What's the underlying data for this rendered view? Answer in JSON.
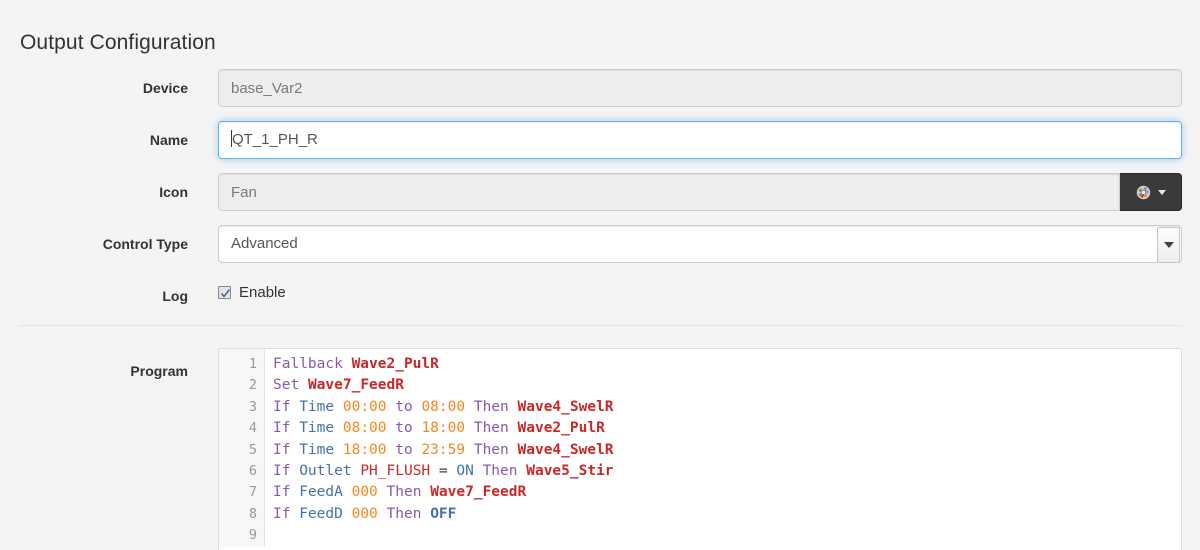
{
  "page": {
    "title": "Output Configuration"
  },
  "form": {
    "device": {
      "label": "Device",
      "value": "base_Var2",
      "readonly": true
    },
    "name": {
      "label": "Name",
      "value": "QT_1_PH_R",
      "focused": true
    },
    "icon": {
      "label": "Icon",
      "value": "Fan",
      "readonly": true,
      "button_icon": "fan-icon",
      "button_caret": "caret-down-icon"
    },
    "control_type": {
      "label": "Control Type",
      "value": "Advanced",
      "options": [
        "Advanced"
      ]
    },
    "log": {
      "label": "Log",
      "checkbox_label": "Enable",
      "checked": true
    },
    "program": {
      "label": "Program"
    }
  },
  "editor": {
    "lines": [
      {
        "number": "1",
        "tokens": [
          {
            "t": "Fallback",
            "c": "kw"
          },
          {
            "t": " ",
            "c": "op"
          },
          {
            "t": "Wave2_PulR",
            "c": "str"
          }
        ]
      },
      {
        "number": "2",
        "tokens": [
          {
            "t": "Set",
            "c": "kw"
          },
          {
            "t": " ",
            "c": "op"
          },
          {
            "t": "Wave7_FeedR",
            "c": "str"
          }
        ]
      },
      {
        "number": "3",
        "tokens": [
          {
            "t": "If",
            "c": "kw"
          },
          {
            "t": " ",
            "c": "op"
          },
          {
            "t": "Time",
            "c": "fn"
          },
          {
            "t": " ",
            "c": "op"
          },
          {
            "t": "00:00",
            "c": "num"
          },
          {
            "t": " ",
            "c": "op"
          },
          {
            "t": "to",
            "c": "kw"
          },
          {
            "t": " ",
            "c": "op"
          },
          {
            "t": "08:00",
            "c": "num"
          },
          {
            "t": " ",
            "c": "op"
          },
          {
            "t": "Then",
            "c": "kw"
          },
          {
            "t": " ",
            "c": "op"
          },
          {
            "t": "Wave4_SwelR",
            "c": "str"
          }
        ]
      },
      {
        "number": "4",
        "tokens": [
          {
            "t": "If",
            "c": "kw"
          },
          {
            "t": " ",
            "c": "op"
          },
          {
            "t": "Time",
            "c": "fn"
          },
          {
            "t": " ",
            "c": "op"
          },
          {
            "t": "08:00",
            "c": "num"
          },
          {
            "t": " ",
            "c": "op"
          },
          {
            "t": "to",
            "c": "kw"
          },
          {
            "t": " ",
            "c": "op"
          },
          {
            "t": "18:00",
            "c": "num"
          },
          {
            "t": " ",
            "c": "op"
          },
          {
            "t": "Then",
            "c": "kw"
          },
          {
            "t": " ",
            "c": "op"
          },
          {
            "t": "Wave2_PulR",
            "c": "str"
          }
        ]
      },
      {
        "number": "5",
        "tokens": [
          {
            "t": "If",
            "c": "kw"
          },
          {
            "t": " ",
            "c": "op"
          },
          {
            "t": "Time",
            "c": "fn"
          },
          {
            "t": " ",
            "c": "op"
          },
          {
            "t": "18:00",
            "c": "num"
          },
          {
            "t": " ",
            "c": "op"
          },
          {
            "t": "to",
            "c": "kw"
          },
          {
            "t": " ",
            "c": "op"
          },
          {
            "t": "23:59",
            "c": "num"
          },
          {
            "t": " ",
            "c": "op"
          },
          {
            "t": "Then",
            "c": "kw"
          },
          {
            "t": " ",
            "c": "op"
          },
          {
            "t": "Wave4_SwelR",
            "c": "str"
          }
        ]
      },
      {
        "number": "6",
        "tokens": [
          {
            "t": "If",
            "c": "kw"
          },
          {
            "t": " ",
            "c": "op"
          },
          {
            "t": "Outlet",
            "c": "fn"
          },
          {
            "t": " ",
            "c": "op"
          },
          {
            "t": "PH_FLUSH",
            "c": "var"
          },
          {
            "t": " ",
            "c": "op"
          },
          {
            "t": "=",
            "c": "op"
          },
          {
            "t": " ",
            "c": "op"
          },
          {
            "t": "ON",
            "c": "fn"
          },
          {
            "t": " ",
            "c": "op"
          },
          {
            "t": "Then",
            "c": "kw"
          },
          {
            "t": " ",
            "c": "op"
          },
          {
            "t": "Wave5_Stir",
            "c": "str"
          }
        ]
      },
      {
        "number": "7",
        "tokens": [
          {
            "t": "If",
            "c": "kw"
          },
          {
            "t": " ",
            "c": "op"
          },
          {
            "t": "FeedA",
            "c": "fn"
          },
          {
            "t": " ",
            "c": "op"
          },
          {
            "t": "000",
            "c": "num"
          },
          {
            "t": " ",
            "c": "op"
          },
          {
            "t": "Then",
            "c": "kw"
          },
          {
            "t": " ",
            "c": "op"
          },
          {
            "t": "Wave7_FeedR",
            "c": "str"
          }
        ]
      },
      {
        "number": "8",
        "tokens": [
          {
            "t": "If",
            "c": "kw"
          },
          {
            "t": " ",
            "c": "op"
          },
          {
            "t": "FeedD",
            "c": "fn"
          },
          {
            "t": " ",
            "c": "op"
          },
          {
            "t": "000",
            "c": "num"
          },
          {
            "t": " ",
            "c": "op"
          },
          {
            "t": "Then",
            "c": "kw"
          },
          {
            "t": " ",
            "c": "op"
          },
          {
            "t": "OFF",
            "c": "fn bold"
          }
        ]
      },
      {
        "number": "9",
        "tokens": []
      }
    ]
  },
  "colors": {
    "page_background": "#f4f4f4",
    "input_border": "#cccccc",
    "focus_border": "#66afe9",
    "readonly_background": "#eeeeee",
    "icon_button_background": "#3a3a3a",
    "keyword": "#8959a8",
    "function": "#4271ae",
    "number": "#f5871f",
    "string": "#c82829",
    "gutter_text": "#999999"
  }
}
